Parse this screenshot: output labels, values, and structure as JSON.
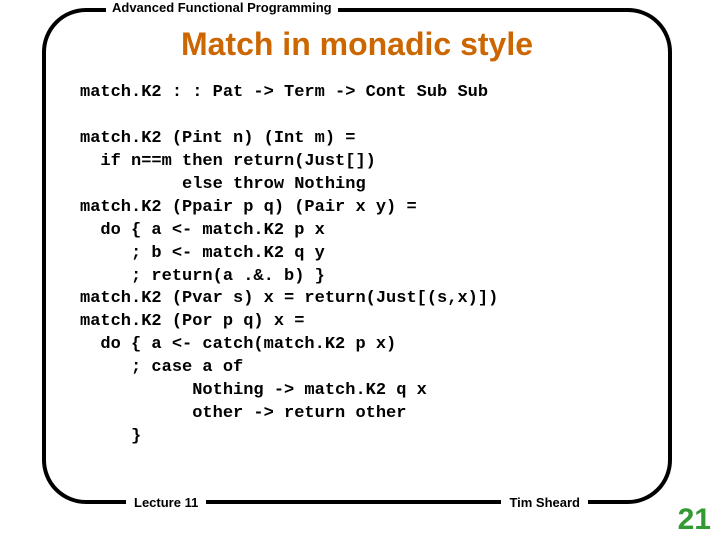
{
  "header": {
    "course": "Advanced Functional Programming"
  },
  "slide": {
    "title": "Match in monadic style",
    "code": "match.K2 : : Pat -> Term -> Cont Sub Sub\n\nmatch.K2 (Pint n) (Int m) =\n  if n==m then return(Just[])\n          else throw Nothing\nmatch.K2 (Ppair p q) (Pair x y) =\n  do { a <- match.K2 p x\n     ; b <- match.K2 q y\n     ; return(a .&. b) }\nmatch.K2 (Pvar s) x = return(Just[(s,x)])\nmatch.K2 (Por p q) x =\n  do { a <- catch(match.K2 p x)\n     ; case a of\n           Nothing -> match.K2 q x\n           other -> return other\n     }"
  },
  "footer": {
    "lecture": "Lecture 11",
    "author": "Tim Sheard",
    "page": "21"
  }
}
